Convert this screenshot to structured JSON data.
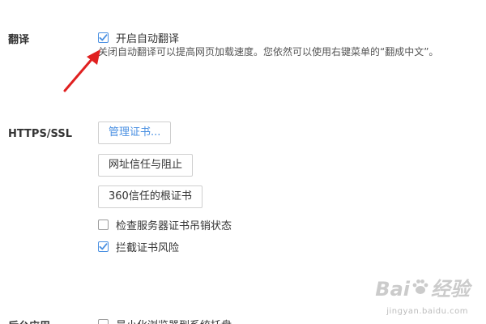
{
  "sections": {
    "translate": {
      "label": "翻译",
      "option_label": "开启自动翻译",
      "option_checked": true,
      "description": "关闭自动翻译可以提高网页加载速度。您依然可以使用右键菜单的“翻成中文”。"
    },
    "https": {
      "label": "HTTPS/SSL",
      "buttons": {
        "manage_certs": "管理证书...",
        "url_trust_block": "网址信任与阻止",
        "root_certs_360": "360信任的根证书"
      },
      "options": {
        "check_revocation": {
          "label": "检查服务器证书吊销状态",
          "checked": false
        },
        "block_cert_risk": {
          "label": "拦截证书风险",
          "checked": true
        }
      }
    },
    "background": {
      "label": "后台应用",
      "option_label": "最小化浏览器到系统托盘",
      "option_checked": false
    }
  },
  "watermark": {
    "brand_left": "Bai",
    "brand_right": "经验",
    "url": "jingyan.baidu.com"
  },
  "colors": {
    "accent": "#4a90e2",
    "arrow": "#e02020"
  }
}
